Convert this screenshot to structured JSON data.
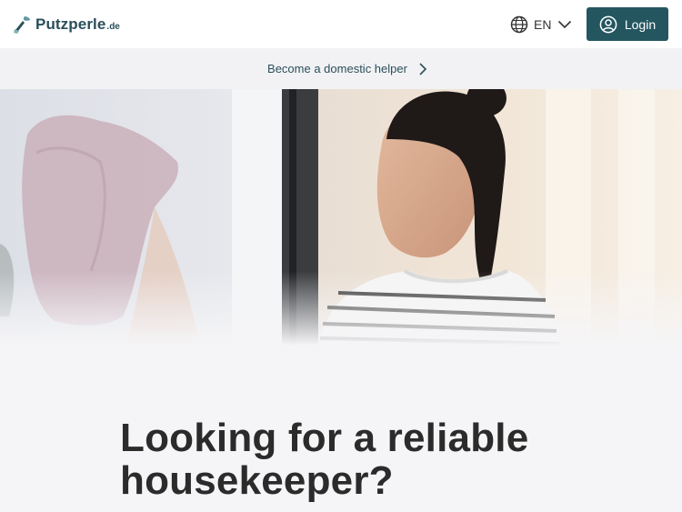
{
  "header": {
    "logo_name": "Putzperle",
    "logo_tld": ".de",
    "language": "EN",
    "login_label": "Login"
  },
  "banner": {
    "text": "Become a domestic helper"
  },
  "hero": {
    "image_alt": ""
  },
  "main": {
    "headline": "Looking for a reliable housekeeper?"
  },
  "colors": {
    "brand": "#245660",
    "text_dark": "#2b2b2b",
    "background": "#f5f5f7"
  },
  "icons": [
    "broom-leaf-icon",
    "globe-icon",
    "chevron-down-icon",
    "user-circle-icon",
    "chevron-right-icon"
  ]
}
